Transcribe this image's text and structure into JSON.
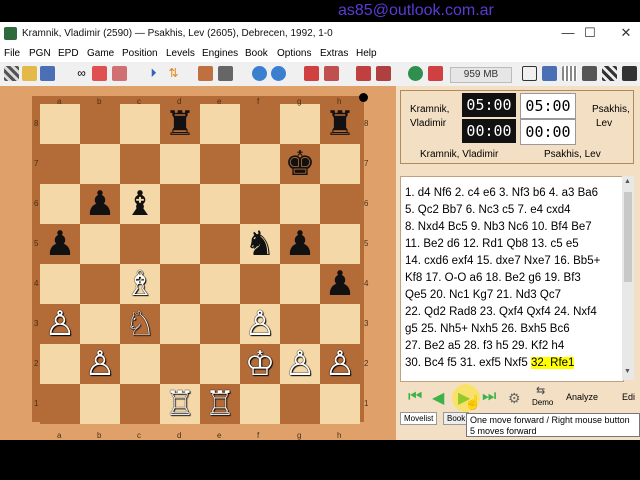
{
  "overlay": {
    "email": "as85@outlook.com.ar"
  },
  "window": {
    "title": "Kramnik, Vladimir (2590)  —  Psakhis, Lev (2605),   Debrecen,   1992,   1-0"
  },
  "menu": [
    "File",
    "PGN",
    "EPD",
    "Game",
    "Position",
    "Levels",
    "Engines",
    "Book",
    "Options",
    "Extras",
    "Help"
  ],
  "toolbar": {
    "memory": "959 MB"
  },
  "board": {
    "files": [
      "a",
      "b",
      "c",
      "d",
      "e",
      "f",
      "g",
      "h"
    ],
    "ranks": [
      "8",
      "7",
      "6",
      "5",
      "4",
      "3",
      "2",
      "1"
    ],
    "pieces": [
      {
        "sq": "d8",
        "glyph": "♜",
        "color": "b",
        "name": "black-rook-d8"
      },
      {
        "sq": "h8",
        "glyph": "♜",
        "color": "b",
        "name": "black-rook-h8"
      },
      {
        "sq": "g7",
        "glyph": "♚",
        "color": "b",
        "name": "black-king-g7"
      },
      {
        "sq": "b6",
        "glyph": "♟",
        "color": "b",
        "name": "black-pawn-b6"
      },
      {
        "sq": "c6",
        "glyph": "♝",
        "color": "b",
        "name": "black-bishop-c6"
      },
      {
        "sq": "a5",
        "glyph": "♟",
        "color": "b",
        "name": "black-pawn-a5"
      },
      {
        "sq": "f5",
        "glyph": "♞",
        "color": "b",
        "name": "black-knight-f5"
      },
      {
        "sq": "g5",
        "glyph": "♟",
        "color": "b",
        "name": "black-pawn-g5"
      },
      {
        "sq": "h4",
        "glyph": "♟",
        "color": "b",
        "name": "black-pawn-h4"
      },
      {
        "sq": "c4",
        "glyph": "♗",
        "color": "w",
        "name": "white-bishop-c4"
      },
      {
        "sq": "a3",
        "glyph": "♙",
        "color": "w",
        "name": "white-pawn-a3"
      },
      {
        "sq": "c3",
        "glyph": "♘",
        "color": "w",
        "name": "white-knight-c3"
      },
      {
        "sq": "f3",
        "glyph": "♙",
        "color": "w",
        "name": "white-pawn-f3"
      },
      {
        "sq": "b2",
        "glyph": "♙",
        "color": "w",
        "name": "white-pawn-b2"
      },
      {
        "sq": "f2",
        "glyph": "♔",
        "color": "w",
        "name": "white-king-f2"
      },
      {
        "sq": "g2",
        "glyph": "♙",
        "color": "w",
        "name": "white-pawn-g2"
      },
      {
        "sq": "h2",
        "glyph": "♙",
        "color": "w",
        "name": "white-pawn-h2"
      },
      {
        "sq": "d1",
        "glyph": "♖",
        "color": "w",
        "name": "white-rook-d1"
      },
      {
        "sq": "e1",
        "glyph": "♖",
        "color": "w",
        "name": "white-rook-e1"
      }
    ]
  },
  "players": {
    "white": {
      "first": "Kramnik,",
      "second": "Vladimir",
      "full": "Kramnik, Vladimir"
    },
    "black": {
      "first": "Psakhis,",
      "second": "Lev",
      "full": "Psakhis, Lev"
    },
    "clocks": {
      "w1": "05:00",
      "w2": "00:00",
      "b1": "05:00",
      "b2": "00:00"
    }
  },
  "movelist": [
    "1. d4 Nf6 2. c4 e6 3. Nf3 b6 4. a3 Ba6",
    "5. Qc2 Bb7 6. Nc3 c5 7. e4 cxd4",
    "8. Nxd4 Bc5 9. Nb3 Nc6 10. Bf4 Be7",
    "11. Be2 d6 12. Rd1 Qb8 13. c5 e5",
    "14. cxd6 exf4 15. dxe7 Nxe7 16. Bb5+",
    "Kf8 17. O-O a6 18. Be2 g6 19. Bf3",
    "Qe5 20. Nc1 Kg7 21. Nd3 Qc7",
    "22. Qd2 Rad8 23. Qxf4 Qxf4 24. Nxf4",
    "g5 25. Nh5+ Nxh5 26. Bxh5 Bc6",
    "27. Be2 a5 28. f3 h5 29. Kf2 h4"
  ],
  "lastline": {
    "prefix": "30. Bc4 f5 31. exf5 Nxf5",
    "current": "32. Rfe1"
  },
  "nav": {
    "demo": "Demo",
    "analyze": "Analyze",
    "edit": "Edi"
  },
  "tabs": {
    "movelist": "Movelist",
    "book": "Book"
  },
  "tooltip": {
    "line1": "One move forward / Right mouse button",
    "line2": "5 moves forward"
  }
}
